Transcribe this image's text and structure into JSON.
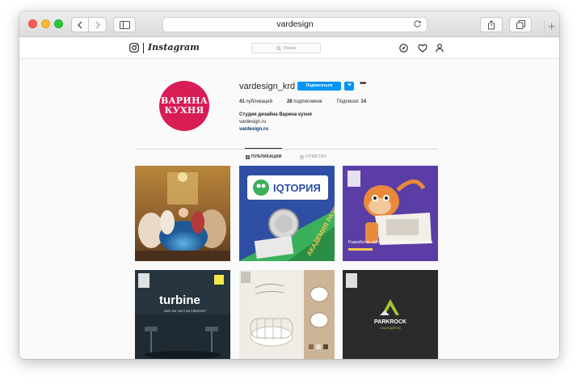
{
  "browser": {
    "address": "vardesign",
    "plus_label": "+"
  },
  "ig": {
    "wordmark": "Instagram",
    "search_placeholder": "Поиск"
  },
  "profile": {
    "avatar_line1": "ВАРИНА",
    "avatar_line2": "КУХНЯ",
    "username": "vardesign_krd",
    "follow_label": "Подписаться",
    "posts_count": "41",
    "posts_label": "публикаций",
    "followers_count": "28",
    "followers_label": "подписчиков",
    "following_label": "Подписки:",
    "following_count": "14",
    "bio_name": "Студия дизайна Варина кухня",
    "bio_line": "vardesign.ru",
    "bio_link": "vardesign.ru"
  },
  "tabs": {
    "posts": "ПУБЛИКАЦИИ",
    "tagged": "ОТМЕТКИ"
  },
  "posts": {
    "p2_title": "IQТОРИЯ",
    "p2_side_text": "АКАДЕМИЯ РАЗВИТИЯ",
    "p3_caption": "Разработка сайта для российского агентства",
    "p4_title": "turbine",
    "p4_subtitle": "own we can't an interiors?",
    "p6_title": "PARKROCK",
    "p6_subtitle": "СКАЛОДРОМ"
  },
  "colors": {
    "follow_blue": "#0095f6",
    "avatar_red": "#d81c54",
    "iqtoria_blue": "#2e4fa3",
    "iqtoria_green": "#3bb05a",
    "purple_bg": "#5a3ea6",
    "parkrock_dark": "#2b2b2b",
    "parkrock_green": "#a4c639"
  }
}
